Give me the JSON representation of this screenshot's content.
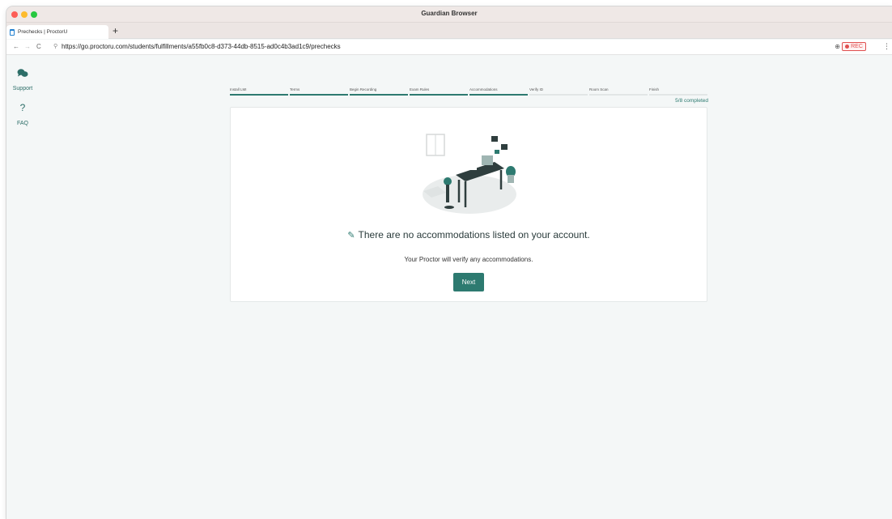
{
  "window": {
    "title": "Guardian Browser"
  },
  "tabs": [
    {
      "label": "Prechecks | ProctorU"
    }
  ],
  "new_tab_glyph": "+",
  "address": {
    "back_glyph": "←",
    "forward_glyph": "→",
    "reload_glyph": "C",
    "search_glyph": "⚲",
    "url": "https://go.proctoru.com/students/fulfillments/a55fb0c8-d373-44db-8515-ad0c4b3ad1c9/prechecks",
    "zoom_glyph": "⊕",
    "rec_label": "REC",
    "menu_glyph": "⋮"
  },
  "sidebar": {
    "support_label": "Support",
    "support_icon": "chat-bubbles-icon",
    "faq_glyph": "?",
    "faq_label": "FAQ"
  },
  "stepper": {
    "steps": [
      {
        "label": "Install LMI",
        "done": true
      },
      {
        "label": "Terms",
        "done": true
      },
      {
        "label": "Begin Recording",
        "done": true
      },
      {
        "label": "Exam Rules",
        "done": true
      },
      {
        "label": "Accommodations",
        "done": true
      },
      {
        "label": "Verify ID",
        "done": false
      },
      {
        "label": "Room Scan",
        "done": false
      },
      {
        "label": "Finish",
        "done": false
      }
    ],
    "completed": 5,
    "total": 8,
    "progress_text": "5/8 completed"
  },
  "card": {
    "pencil_glyph": "✎",
    "headline": "There are no accommodations listed on your account.",
    "subtext": "Your Proctor will verify any accommodations.",
    "next_label": "Next"
  },
  "colors": {
    "accent": "#2d7a70",
    "background": "#f4f7f7",
    "rec": "#e05050"
  }
}
